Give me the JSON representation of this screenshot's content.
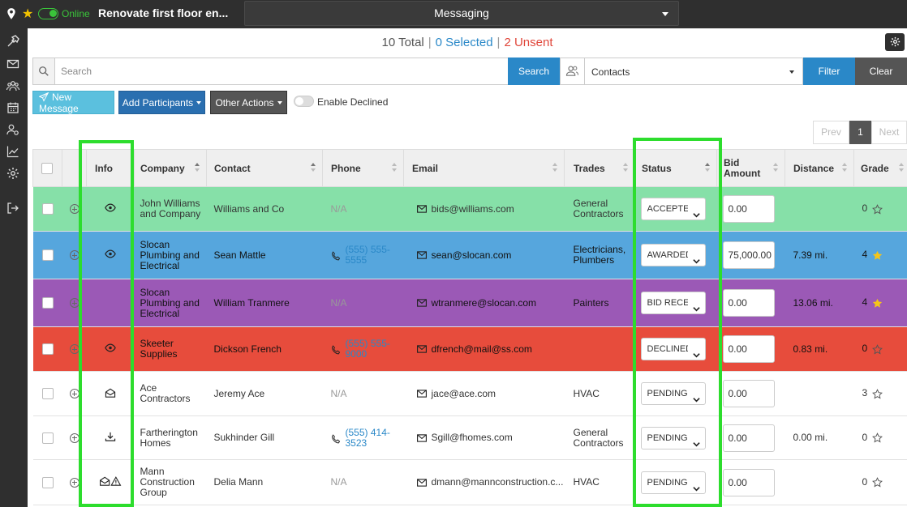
{
  "topbar": {
    "online": "Online",
    "project": "Renovate first floor en...",
    "module": "Messaging"
  },
  "summary": {
    "total": "10 Total",
    "selected": "0 Selected",
    "unsent": "2 Unsent",
    "separator": "|"
  },
  "search": {
    "placeholder": "Search",
    "button": "Search",
    "contacts_value": "Contacts",
    "filter": "Filter",
    "clear": "Clear"
  },
  "actions": {
    "new_message": "New Message",
    "add_participants": "Add Participants",
    "other_actions": "Other Actions",
    "enable_declined": "Enable Declined"
  },
  "pager": {
    "prev": "Prev",
    "page": "1",
    "next": "Next"
  },
  "columns": {
    "info": "Info",
    "company": "Company",
    "contact": "Contact",
    "phone": "Phone",
    "email": "Email",
    "trades": "Trades",
    "status": "Status",
    "bid_amount": "Bid Amount",
    "distance": "Distance",
    "grade": "Grade"
  },
  "rows": [
    {
      "company": "John Williams and Company",
      "contact": "Williams and Co",
      "phone": "N/A",
      "email": "bids@williams.com",
      "trades": "General Contractors",
      "status": "ACCEPTED",
      "bid": "0.00",
      "distance": "",
      "grade": "0",
      "info_icon": "eye-icon",
      "color": "#86e0a8"
    },
    {
      "company": "Slocan Plumbing and Electrical",
      "contact": "Sean Mattle",
      "phone": "(555) 555-5555",
      "email": "sean@slocan.com",
      "trades": "Electricians, Plumbers",
      "status": "AWARDED",
      "bid": "75,000.00",
      "distance": "7.39 mi.",
      "grade": "4",
      "info_icon": "eye-icon",
      "color": "#56a6dd"
    },
    {
      "company": "Slocan Plumbing and Electrical",
      "contact": "William Tranmere",
      "phone": "N/A",
      "email": "wtranmere@slocan.com",
      "trades": "Painters",
      "status": "BID RECEIVED",
      "bid": "0.00",
      "distance": "13.06 mi.",
      "grade": "4",
      "info_icon": "",
      "color": "#9b59b6"
    },
    {
      "company": "Skeeter Supplies",
      "contact": "Dickson French",
      "phone": "(555) 555-9000",
      "email": "dfrench@mail@ss.com",
      "trades": "",
      "status": "DECLINED",
      "bid": "0.00",
      "distance": "0.83 mi.",
      "grade": "0",
      "info_icon": "eye-icon",
      "color": "#e74c3c"
    },
    {
      "company": "Ace Contractors",
      "contact": "Jeremy Ace",
      "phone": "N/A",
      "email": "jace@ace.com",
      "trades": "HVAC",
      "status": "PENDING",
      "bid": "0.00",
      "distance": "",
      "grade": "3",
      "info_icon": "envelope-open-icon",
      "color": "#ffffff"
    },
    {
      "company": "Fartherington Homes",
      "contact": "Sukhinder Gill",
      "phone": "(555) 414-3523",
      "email": "Sgill@fhomes.com",
      "trades": "General Contractors",
      "status": "PENDING",
      "bid": "0.00",
      "distance": "0.00 mi.",
      "grade": "0",
      "info_icon": "download-icon",
      "color": "#ffffff"
    },
    {
      "company": "Mann Construction Group",
      "contact": "Delia Mann",
      "phone": "N/A",
      "email": "dmann@mannconstruction.c...",
      "trades": "HVAC",
      "status": "PENDING",
      "bid": "0.00",
      "distance": "",
      "grade": "0",
      "info_icon": "envelope-warning-icon",
      "color": "#ffffff"
    }
  ]
}
